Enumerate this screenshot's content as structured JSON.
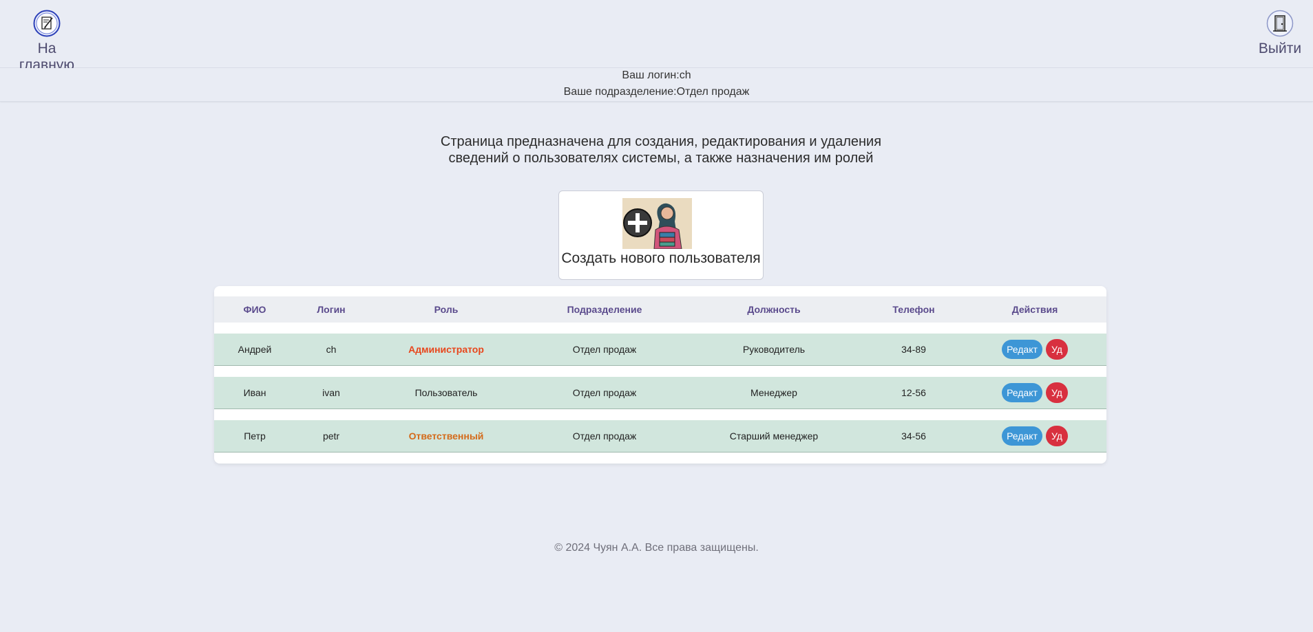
{
  "nav": {
    "home_label": "На главную",
    "exit_label": "Выйти"
  },
  "info": {
    "login_line": "Ваш логин:ch",
    "department_line": "Ваше подразделение:Отдел продаж"
  },
  "description": {
    "line1": "Страница предназначена для создания, редактирования и удаления",
    "line2": "сведений о пользователях системы, а также назначения им ролей"
  },
  "create_user": {
    "label": "Создать нового пользователя",
    "icon": "add-user-illustration"
  },
  "table": {
    "headers": [
      "ФИО",
      "Логин",
      "Роль",
      "Подразделение",
      "Должность",
      "Телефон",
      "Действия"
    ],
    "rows": [
      {
        "name": "Андрей",
        "login": "ch",
        "role": "Администратор",
        "department": "Отдел продаж",
        "position": "Руководитель",
        "phone": "34-89",
        "edit": "Редакт",
        "delete": "Уд"
      },
      {
        "name": "Иван",
        "login": "ivan",
        "role": "Пользователь",
        "department": "Отдел продаж",
        "position": "Менеджер",
        "phone": "12-56",
        "edit": "Редакт",
        "delete": "Уд"
      },
      {
        "name": "Петр",
        "login": "petr",
        "role": "Ответственный",
        "department": "Отдел продаж",
        "position": "Старший менеджер",
        "phone": "34-56",
        "edit": "Редакт",
        "delete": "Уд"
      }
    ]
  },
  "footer": {
    "text": "© 2024 Чуян А.А. Все права защищены."
  },
  "colors": {
    "background": "#e9ecf4",
    "row_background": "#d1e6dd",
    "header_text": "#5a4a8c",
    "role_admin": "#e8461c",
    "role_responsible": "#d46a1a",
    "edit_button": "#3d96d6",
    "delete_button": "#d8303f"
  }
}
